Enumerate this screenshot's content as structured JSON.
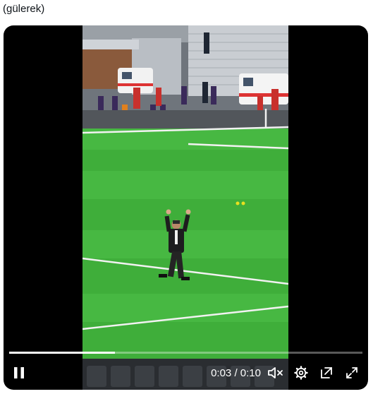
{
  "caption": "(gülerek)",
  "player": {
    "current_time": "0:03",
    "separator": " / ",
    "duration": "0:10",
    "progress": 0.3
  },
  "icons": {
    "play_pause": "pause-icon",
    "volume": "muted-speaker-icon",
    "settings": "gear-icon",
    "popout": "pop-out-icon",
    "fullscreen": "fullscreen-icon"
  },
  "colors": {
    "player_bg": "#000000",
    "pitch_green": "#3fae3a",
    "controls": "#ffffff"
  }
}
